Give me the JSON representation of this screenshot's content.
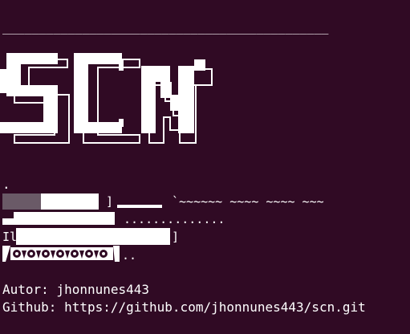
{
  "terminal": {
    "background": "#300a24",
    "foreground": "#ffffff",
    "rule": "_____________________________________________",
    "logo_text": "SCN",
    "dot": ".",
    "tank": {
      "turret_bracket": "]",
      "barrel_waves": "`~~~~~~ ~~~~ ~~~~ ~~~",
      "dots_row": "..............",
      "body_left": "Il",
      "body_right": "]",
      "treads_tail": ".."
    },
    "author_line": "Autor: jhonnunes443",
    "github_line": "Github: https://github.com/jhonnunes443/scn.git"
  }
}
